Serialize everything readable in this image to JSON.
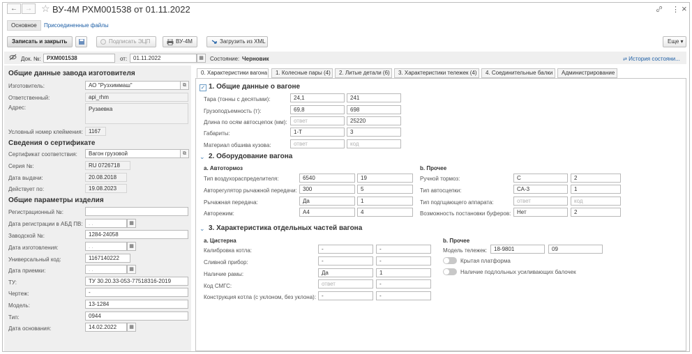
{
  "window": {
    "title": "ВУ-4М РХМ001538 от 01.11.2022",
    "nav_back": "←",
    "nav_forward": "→",
    "star": "☆",
    "link_icon": "🔗",
    "more_icon": "⋮",
    "close_icon": "×"
  },
  "top_tabs": [
    "Основное",
    "Присоединенные файлы"
  ],
  "toolbar": {
    "save_close": "Записать и закрыть",
    "sign": "Подписать ЭЦП",
    "print": "ВУ-4М",
    "load_xml": "Загрузить из XML",
    "more": "Еще"
  },
  "header": {
    "doc_no_label": "Док. №:",
    "doc_no": "РХМ001538",
    "date_label": "от:",
    "date": "01.11.2022",
    "state_label": "Состояние:",
    "state": "Черновик",
    "history": "История состояни..."
  },
  "left": {
    "s1": "Общие данные завода изготовителя",
    "manufacturer_label": "Изготовитель:",
    "manufacturer": "АО \"Рузхиммаш\"",
    "responsible_label": "Ответственный:",
    "responsible": "api_rhm",
    "address_label": "Адрес:",
    "address": "Рузаевка",
    "brand_no_label": "Условный номер клеймения:",
    "brand_no": "1167",
    "s2": "Сведения о сертификате",
    "cert_label": "Сертификат соответствия:",
    "cert": "Вагон грузовой",
    "series_label": "Серия №:",
    "series": "RU 0726718",
    "issue_label": "Дата выдачи:",
    "issue": "20.08.2018",
    "valid_label": "Действует по:",
    "valid": "19.08.2023",
    "s3": "Общие параметры изделия",
    "reg_no_label": "Регистрационный №:",
    "reg_no": "",
    "reg_date_label": "Дата регистрации в АБД ПВ:",
    "reg_date": ". .",
    "factory_no_label": "Заводской №:",
    "factory_no": "1284-24058",
    "made_label": "Дата изготовления:",
    "made": ". .",
    "univ_label": "Универсальный код:",
    "univ": "1167140222",
    "accept_label": "Дата приемки:",
    "accept": ". .",
    "tu_label": "ТУ:",
    "tu": "ТУ 30.20.33-053-77518316-2019",
    "drawing_label": "Чертеж:",
    "drawing": "-",
    "model_label": "Модель:",
    "model": "13-1284",
    "type_label": "Тип:",
    "type": "0944",
    "basis_label": "Дата основания:",
    "basis": "14.02.2022"
  },
  "tabs": [
    "0. Характеристики вагона",
    "1. Колесные пары (4)",
    "2. Литые детали (6)",
    "3. Характеристики тележек (4)",
    "4. Соединительные балки",
    "Администрирование"
  ],
  "sec1": {
    "title": "1. Общие данные о вагоне",
    "rows": [
      {
        "label": "Тара (тонны с десятыми):",
        "a": "24,1",
        "b": "241"
      },
      {
        "label": "Грузоподъемность (т):",
        "a": "69,8",
        "b": "698"
      },
      {
        "label": "Длина по осям автосцепок (мм):",
        "a": "ответ",
        "b": "25220"
      },
      {
        "label": "Габариты:",
        "a": "1-Т",
        "b": "3"
      },
      {
        "label": "Материал обшива кузова:",
        "a": "ответ",
        "b": "код"
      }
    ]
  },
  "sec2": {
    "title": "2. Оборудование вагона",
    "sub_a": "a. Автотормоз",
    "sub_b": "b. Прочее",
    "rows_a": [
      {
        "label": "Тип воздухораспределителя:",
        "a": "6540",
        "b": "19"
      },
      {
        "label": "Авторегулятор рычажной передачи:",
        "a": "300",
        "b": "5"
      },
      {
        "label": "Рычажная передача:",
        "a": "Да",
        "b": "1"
      },
      {
        "label": "Авторежим:",
        "a": "А4",
        "b": "4"
      }
    ],
    "rows_b": [
      {
        "label": "Ручной тормоз:",
        "a": "С",
        "b": "2"
      },
      {
        "label": "Тип автосцепки:",
        "a": "СА-3",
        "b": "1"
      },
      {
        "label": "Тип подгщающего аппарата:",
        "a": "ответ",
        "b": "код"
      },
      {
        "label": "Возможность постановки буферов:",
        "a": "Нет",
        "b": "2"
      }
    ]
  },
  "sec3": {
    "title": "3. Характеристика отдельных частей вагона",
    "sub_a": "a. Цистерна",
    "sub_b": "b. Прочее",
    "rows_a": [
      {
        "label": "Калибровка котла:",
        "a": "-",
        "b": "-"
      },
      {
        "label": "Сливной прибор:",
        "a": "-",
        "b": "-"
      },
      {
        "label": "Наличие рамы:",
        "a": "Да",
        "b": "1"
      },
      {
        "label": "Код СМГС:",
        "a": "ответ",
        "b": "-"
      },
      {
        "label": "Конструкция котла (с уклоном, без уклона):",
        "a": "-",
        "b": "-"
      }
    ],
    "bogie_label": "Модель тележек:",
    "bogie_a": "18-9801",
    "bogie_b": "09",
    "toggle1": "Крытая платформа",
    "toggle2": "Наличие подлольных усиливающих балочек"
  }
}
